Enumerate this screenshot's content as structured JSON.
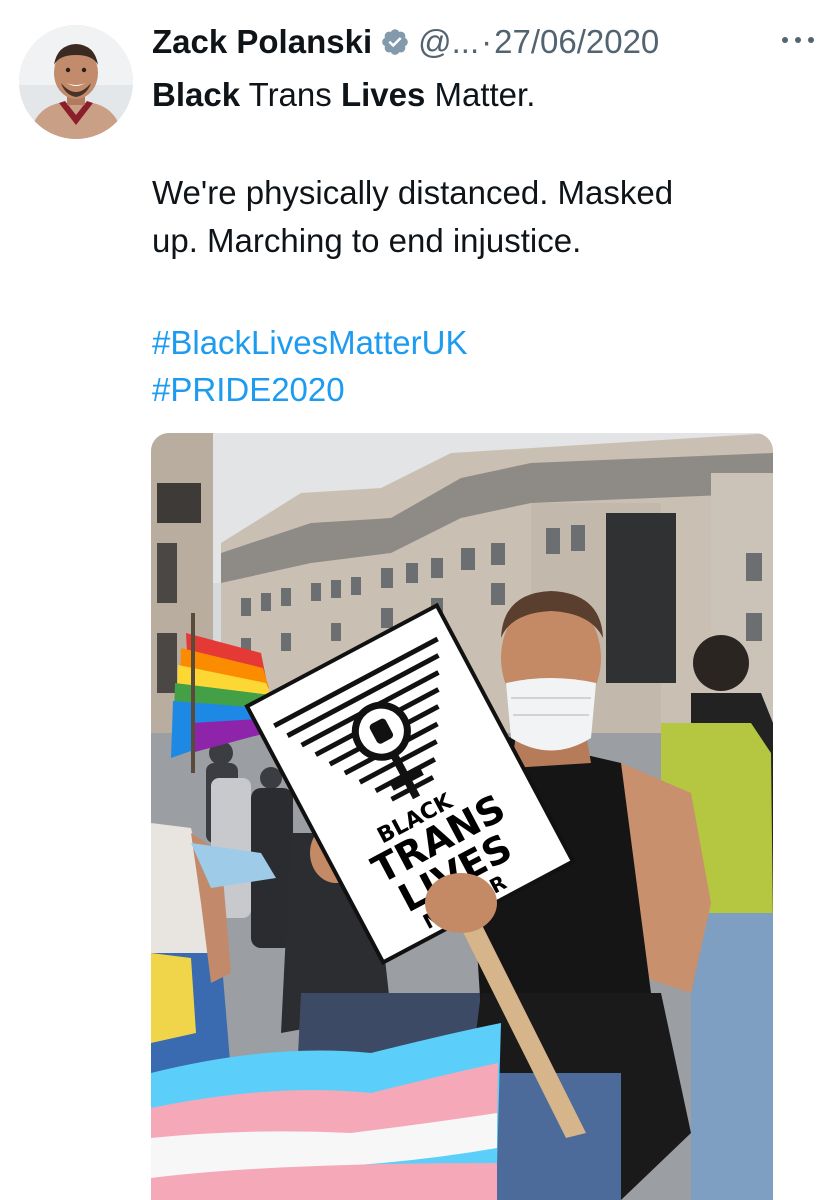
{
  "tweet": {
    "author_name": "Zack Polanski",
    "handle": "@...",
    "separator": "·",
    "date": "27/06/2020",
    "text_line1_bold1": "Black",
    "text_line1_mid": " Trans ",
    "text_line1_bold2": "Lives",
    "text_line1_end": " Matter.",
    "text_line2": "We're physically distanced. Masked",
    "text_line3": "up. Marching to end injustice.",
    "hashtags": [
      "#BlackLivesMatterUK",
      "#PRIDE2020"
    ]
  },
  "sign": {
    "line1": "BLACK",
    "line2": "TRANS",
    "line3": "LIVES",
    "line4": "MATTER"
  },
  "colors": {
    "link": "#1d9bf0",
    "verified": "#829aab",
    "secondary_text": "#536471"
  },
  "icons": {
    "verified": "verified-badge-icon",
    "more": "more-options-icon"
  }
}
